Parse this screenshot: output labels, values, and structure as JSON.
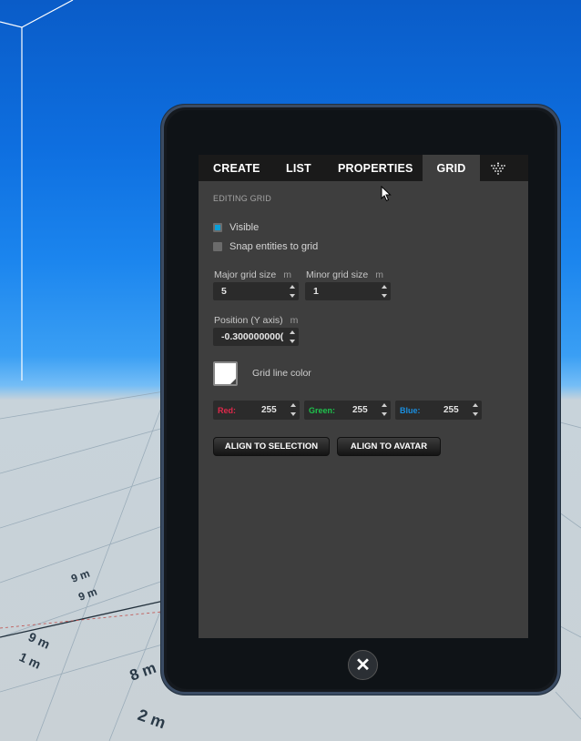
{
  "tabs": {
    "create": "CREATE",
    "list": "LIST",
    "properties": "PROPERTIES",
    "grid": "GRID",
    "more_icon": "marketplace-icon"
  },
  "panel": {
    "section_title": "EDITING GRID",
    "visible_label": "Visible",
    "visible_checked": true,
    "snap_label": "Snap entities to grid",
    "snap_checked": false,
    "major_label": "Major grid size",
    "major_unit": "m",
    "major_value": "5",
    "minor_label": "Minor grid size",
    "minor_unit": "m",
    "minor_value": "1",
    "position_label": "Position (Y axis)",
    "position_unit": "m",
    "position_value": "-0.300000000(",
    "color_label": "Grid line color",
    "grid_color": "#ffffff",
    "red_label": "Red:",
    "red_value": "255",
    "green_label": "Green:",
    "green_value": "255",
    "blue_label": "Blue:",
    "blue_value": "255",
    "align_selection": "ALIGN TO SELECTION",
    "align_avatar": "ALIGN TO AVATAR"
  },
  "scene_labels": [
    "9 m",
    "9 m",
    "9 m",
    "1 m",
    "8 m",
    "2 m"
  ],
  "colors": {
    "accent_checkbox": "#0b9fd8",
    "red_label": "#e0284b",
    "green_label": "#1ec24c",
    "blue_label": "#1a8fe0"
  }
}
